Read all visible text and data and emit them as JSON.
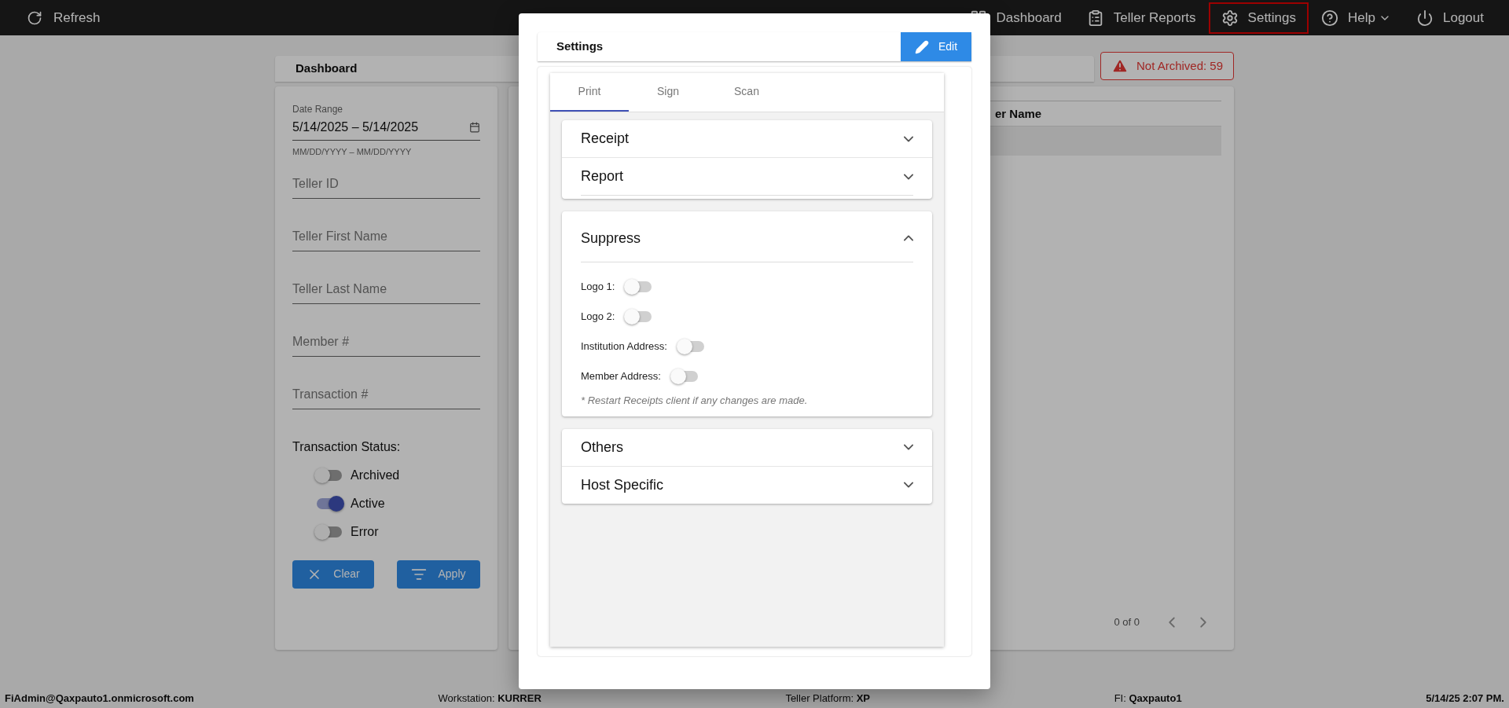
{
  "topbar": {
    "refresh": "Refresh",
    "nav": [
      {
        "kind": "dashboard",
        "label": "Dashboard",
        "selected": false
      },
      {
        "kind": "reports",
        "label": "Teller Reports",
        "selected": false
      },
      {
        "kind": "settings",
        "label": "Settings",
        "selected": true
      },
      {
        "kind": "help",
        "label": "Help",
        "selected": false
      },
      {
        "kind": "logout",
        "label": "Logout",
        "selected": false
      }
    ]
  },
  "dashboard": {
    "title": "Dashboard",
    "badge": "Not Archived: 59",
    "date_range": {
      "label": "Date Range",
      "value": "5/14/2025 – 5/14/2025",
      "hint": "MM/DD/YYYY – MM/DD/YYYY"
    },
    "fields": [
      {
        "placeholder": "Teller ID"
      },
      {
        "placeholder": "Teller First Name"
      },
      {
        "placeholder": "Teller Last Name"
      },
      {
        "placeholder": "Member #"
      },
      {
        "placeholder": "Transaction #"
      }
    ],
    "status": {
      "label": "Transaction Status:",
      "toggles": [
        {
          "label": "Archived",
          "on": false
        },
        {
          "label": "Active",
          "on": true
        },
        {
          "label": "Error",
          "on": false
        }
      ]
    },
    "buttons": [
      {
        "kind": "clear",
        "label": "Clear"
      },
      {
        "kind": "apply",
        "label": "Apply"
      }
    ],
    "table": {
      "columns": [
        "er Name"
      ],
      "pagination": "0 of 0"
    }
  },
  "modal": {
    "title": "Settings",
    "edit": "Edit",
    "tabs": [
      {
        "label": "Print",
        "selected": true
      },
      {
        "label": "Sign",
        "selected": false
      },
      {
        "label": "Scan",
        "selected": false
      }
    ],
    "groups": [
      {
        "sections": [
          {
            "title": "Receipt",
            "expanded": false
          },
          {
            "title": "Report",
            "expanded": false
          }
        ]
      },
      {
        "sections": [
          {
            "title": "Suppress",
            "expanded": true,
            "items": [
              {
                "label": "Logo 1:",
                "on": false
              },
              {
                "label": "Logo 2:",
                "on": false
              },
              {
                "label": "Institution Address:",
                "on": false
              },
              {
                "label": "Member Address:",
                "on": false
              }
            ],
            "note": "* Restart Receipts client if any changes are made."
          }
        ]
      },
      {
        "sections": [
          {
            "title": "Others",
            "expanded": false
          },
          {
            "title": "Host Specific",
            "expanded": false
          }
        ]
      }
    ]
  },
  "status_bar": [
    "**FiAdmin@Qaxpauto1.onmicrosoft.com**",
    "Workstation: **KURRER**",
    "Teller Platform: **XP**",
    "FI: **Qaxpauto1**",
    "**5/14/25 2:07 PM.**"
  ]
}
